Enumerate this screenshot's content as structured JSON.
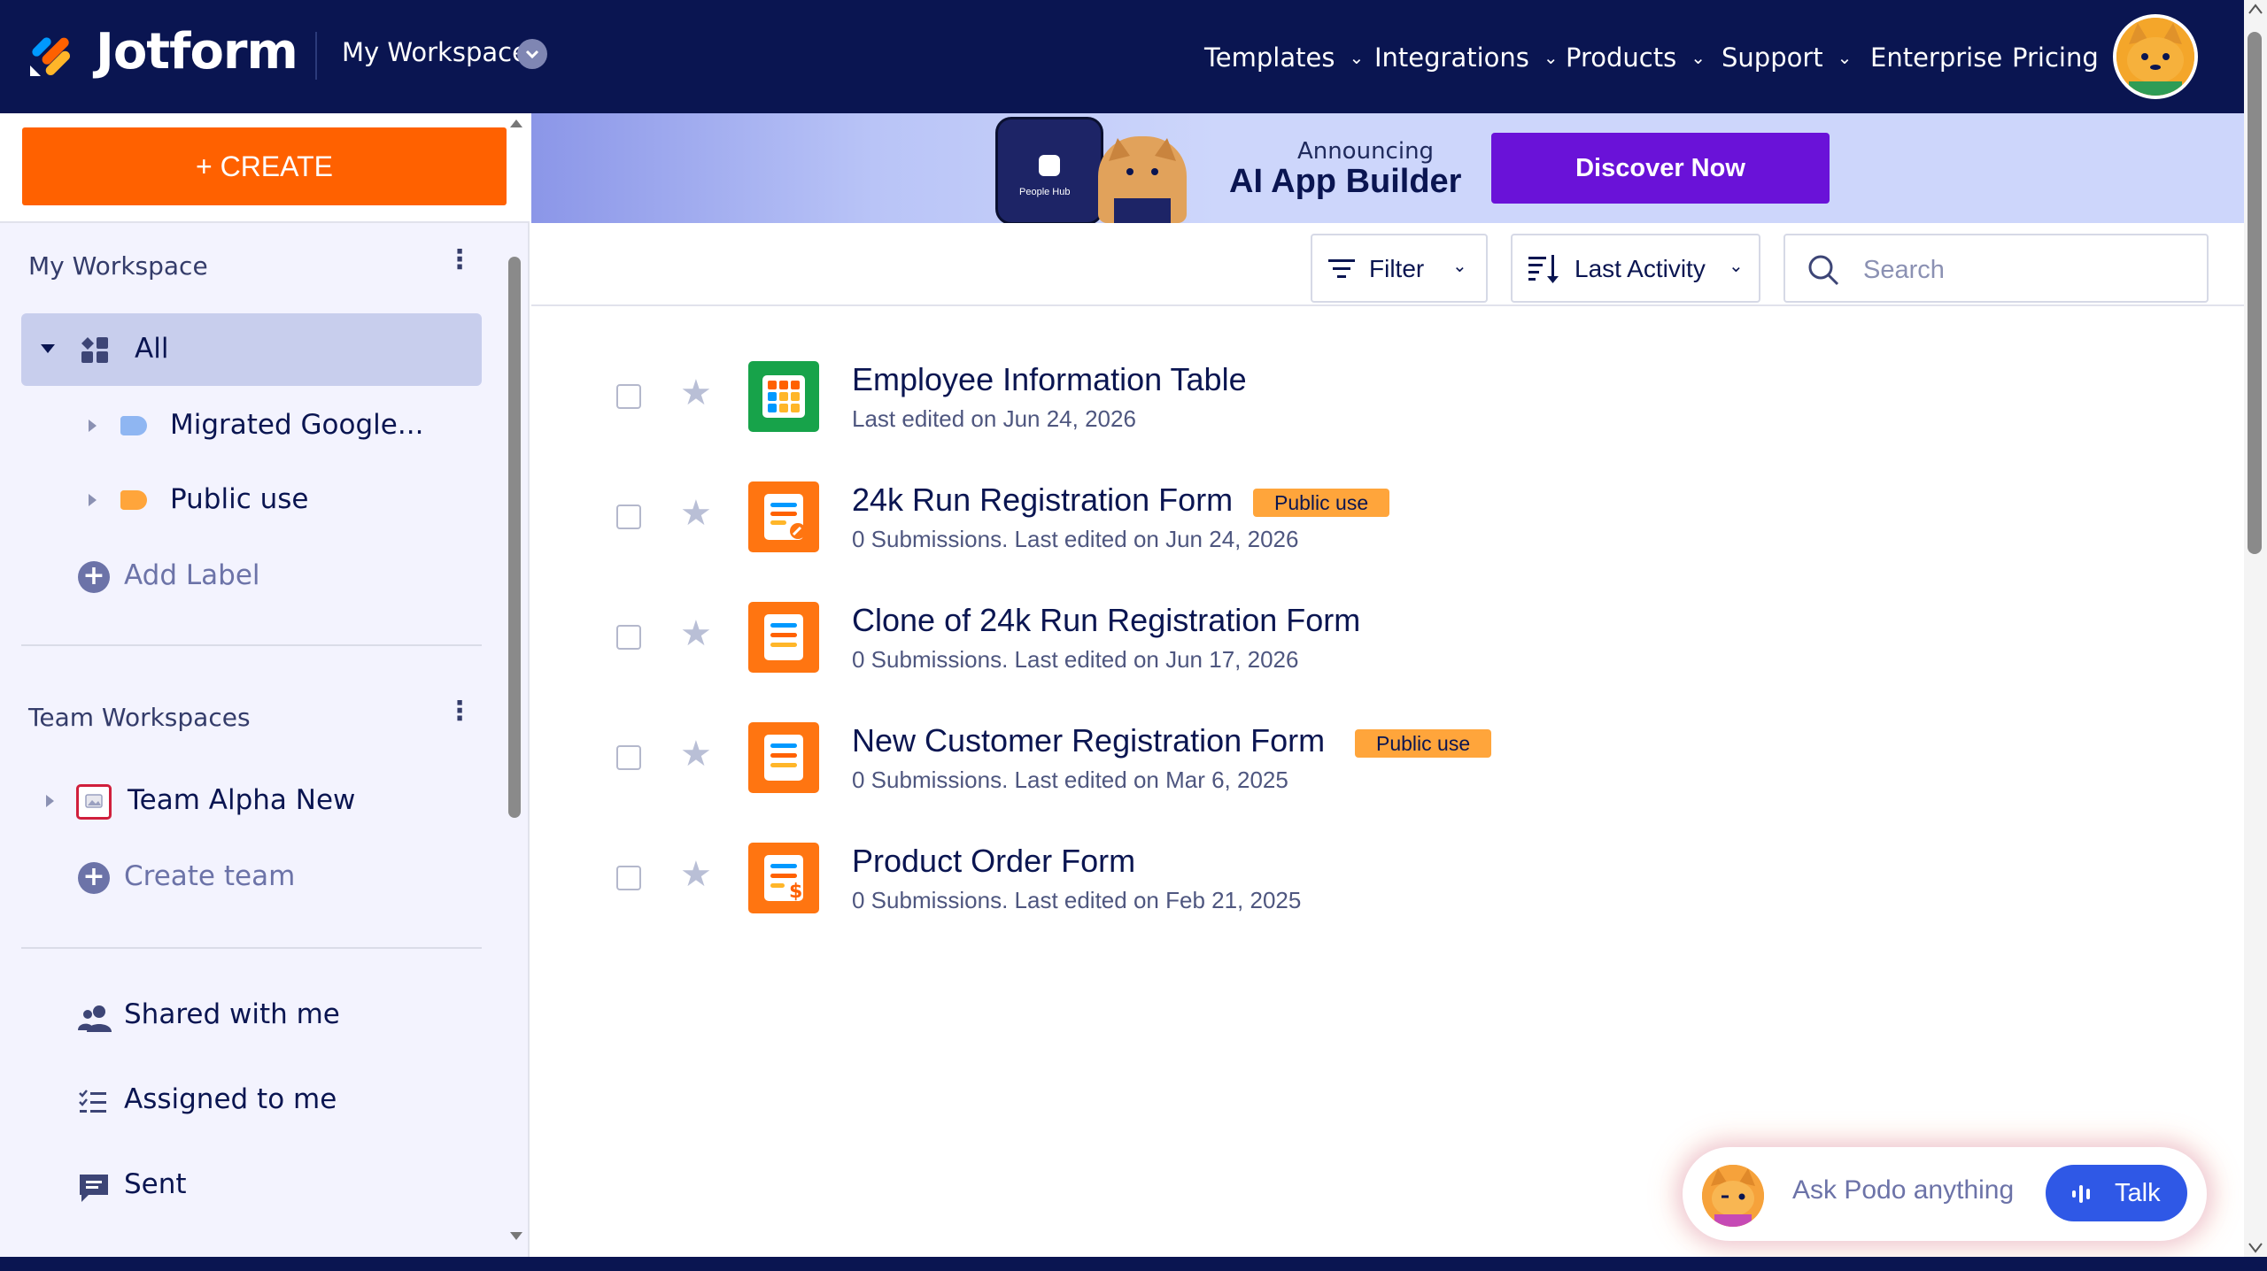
{
  "brand": "Jotform",
  "topnav": {
    "workspace_switch": "My Workspace",
    "items": [
      {
        "label": "Templates"
      },
      {
        "label": "Integrations"
      },
      {
        "label": "Products"
      },
      {
        "label": "Support"
      },
      {
        "label": "Enterprise"
      },
      {
        "label": "Pricing"
      }
    ]
  },
  "sidebar": {
    "create_label": "+ CREATE",
    "my_workspace_title": "My Workspace",
    "all_label": "All",
    "labels": [
      {
        "name": "Migrated Google...",
        "color": "#8fb6f2"
      },
      {
        "name": "Public use",
        "color": "#ffa53b"
      }
    ],
    "add_label": "Add Label",
    "team_title": "Team Workspaces",
    "team_name": "Team Alpha New",
    "create_team": "Create team",
    "nav": [
      {
        "label": "Shared with me",
        "icon": "people-icon"
      },
      {
        "label": "Assigned to me",
        "icon": "checklist-icon"
      },
      {
        "label": "Sent",
        "icon": "message-icon"
      }
    ]
  },
  "banner": {
    "small": "Announcing",
    "big": "AI App Builder",
    "button": "Discover Now",
    "phone_text": "People Hub"
  },
  "toolbar": {
    "filter": "Filter",
    "sort": "Last Activity",
    "search_placeholder": "Search"
  },
  "forms": [
    {
      "title": "Employee Information Table",
      "subtitle": "Last edited on Jun 24, 2026",
      "badge": "",
      "icon": "table-icon"
    },
    {
      "title": "24k Run Registration Form",
      "subtitle": "0 Submissions. Last edited on Jun 24, 2026",
      "badge": "Public use",
      "icon": "form-edit-icon"
    },
    {
      "title": "Clone of 24k Run Registration Form",
      "subtitle": "0 Submissions. Last edited on Jun 17, 2026",
      "badge": "",
      "icon": "form-icon"
    },
    {
      "title": "New Customer Registration Form",
      "subtitle": "0 Submissions. Last edited on Mar 6, 2025",
      "badge": "Public use",
      "icon": "form-icon"
    },
    {
      "title": "Product Order Form",
      "subtitle": "0 Submissions. Last edited on Feb 21, 2025",
      "badge": "",
      "icon": "form-payment-icon"
    }
  ],
  "podo": {
    "prompt": "Ask Podo anything",
    "talk": "Talk"
  },
  "colors": {
    "nav_bg": "#0a1551",
    "create": "#ff6100",
    "discover": "#6a12d8",
    "badge": "#ffa53b",
    "talk": "#2f58e6"
  }
}
